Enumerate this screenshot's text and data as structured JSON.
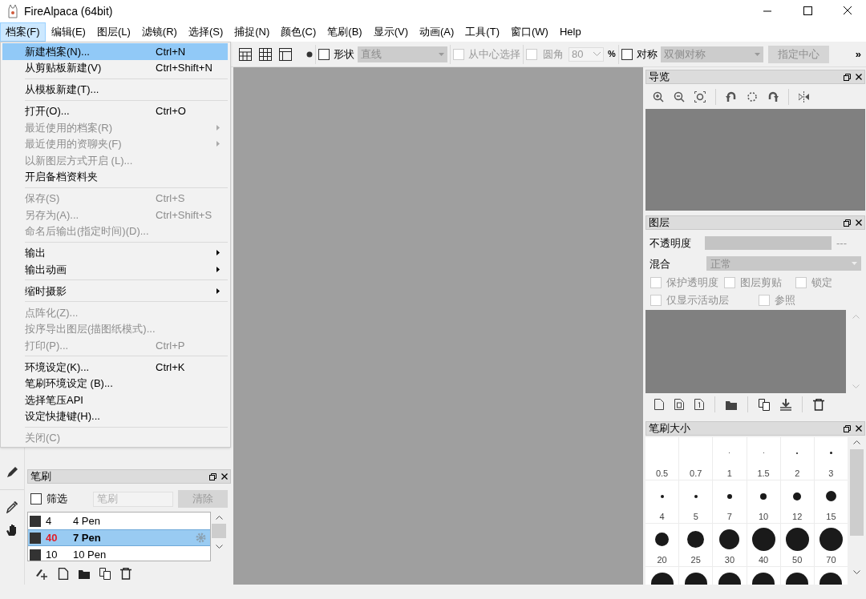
{
  "window": {
    "title": "FireAlpaca (64bit)"
  },
  "menu_bar": [
    {
      "label": "档案(F)",
      "selected": true
    },
    {
      "label": "编辑(E)",
      "selected": false
    },
    {
      "label": "图层(L)",
      "selected": false
    },
    {
      "label": "滤镜(R)",
      "selected": false
    },
    {
      "label": "选择(S)",
      "selected": false
    },
    {
      "label": "捕捉(N)",
      "selected": false
    },
    {
      "label": "颜色(C)",
      "selected": false
    },
    {
      "label": "笔刷(B)",
      "selected": false
    },
    {
      "label": "显示(V)",
      "selected": false
    },
    {
      "label": "动画(A)",
      "selected": false
    },
    {
      "label": "工具(T)",
      "selected": false
    },
    {
      "label": "窗口(W)",
      "selected": false
    },
    {
      "label": "Help",
      "selected": false
    }
  ],
  "toolbar": {
    "shape": {
      "label": "形状",
      "checked": false
    },
    "shape_type": {
      "value": "直线",
      "disabled": true
    },
    "from_center": {
      "label": "从中心选择",
      "checked": false,
      "disabled": true
    },
    "rounded": {
      "label": "圆角",
      "checked": false,
      "disabled": true
    },
    "corner": {
      "value": "80",
      "disabled": true
    },
    "percent": "%",
    "symmetry": {
      "label": "对称",
      "checked": false
    },
    "symmetry_type": {
      "value": "双侧对称",
      "disabled": true
    },
    "set_center": {
      "label": "指定中心",
      "disabled": true
    },
    "overflow": "»"
  },
  "file_menu": [
    {
      "kind": "item",
      "label": "新建档案(N)...",
      "shortcut": "Ctrl+N",
      "disabled": false,
      "submenu": false,
      "selected": true
    },
    {
      "kind": "item",
      "label": "从剪贴板新建(V)",
      "shortcut": "Ctrl+Shift+N",
      "disabled": false,
      "submenu": false,
      "selected": false
    },
    {
      "kind": "separator"
    },
    {
      "kind": "item",
      "label": "从模板新建(T)...",
      "disabled": false,
      "submenu": false,
      "selected": false
    },
    {
      "kind": "separator"
    },
    {
      "kind": "item",
      "label": "打开(O)...",
      "shortcut": "Ctrl+O",
      "disabled": false,
      "submenu": false,
      "selected": false
    },
    {
      "kind": "item",
      "label": "最近使用的档案(R)",
      "disabled": true,
      "submenu": true,
      "selected": false
    },
    {
      "kind": "item",
      "label": "最近使用的资聊夹(F)",
      "disabled": true,
      "submenu": true,
      "selected": false
    },
    {
      "kind": "item",
      "label": "以新图层方式开启 (L)...",
      "disabled": true,
      "submenu": false,
      "selected": false
    },
    {
      "kind": "item",
      "label": "开启备档资料夹",
      "disabled": false,
      "submenu": false,
      "selected": false
    },
    {
      "kind": "separator"
    },
    {
      "kind": "item",
      "label": "保存(S)",
      "shortcut": "Ctrl+S",
      "disabled": true,
      "submenu": false,
      "selected": false
    },
    {
      "kind": "item",
      "label": "另存为(A)...",
      "shortcut": "Ctrl+Shift+S",
      "disabled": true,
      "submenu": false,
      "selected": false
    },
    {
      "kind": "item",
      "label": "命名后输出(指定时间)(D)...",
      "disabled": true,
      "submenu": false,
      "selected": false
    },
    {
      "kind": "separator"
    },
    {
      "kind": "item",
      "label": "输出",
      "disabled": false,
      "submenu": true,
      "selected": false
    },
    {
      "kind": "item",
      "label": "输出动画",
      "disabled": false,
      "submenu": true,
      "selected": false
    },
    {
      "kind": "separator"
    },
    {
      "kind": "item",
      "label": "缩时摄影",
      "disabled": false,
      "submenu": true,
      "selected": false
    },
    {
      "kind": "separator"
    },
    {
      "kind": "item",
      "label": "点阵化(Z)...",
      "disabled": true,
      "submenu": false,
      "selected": false
    },
    {
      "kind": "item",
      "label": "按序导出图层(描图纸模式)...",
      "disabled": true,
      "submenu": false,
      "selected": false
    },
    {
      "kind": "item",
      "label": "打印(P)...",
      "shortcut": "Ctrl+P",
      "disabled": true,
      "submenu": false,
      "selected": false
    },
    {
      "kind": "separator"
    },
    {
      "kind": "item",
      "label": "环境设定(K)...",
      "shortcut": "Ctrl+K",
      "disabled": false,
      "submenu": false,
      "selected": false
    },
    {
      "kind": "item",
      "label": "笔刷环境设定 (B)...",
      "disabled": false,
      "submenu": false,
      "selected": false
    },
    {
      "kind": "item",
      "label": "选择笔压API",
      "disabled": false,
      "submenu": false,
      "selected": false
    },
    {
      "kind": "item",
      "label": "设定快捷键(H)...",
      "disabled": false,
      "submenu": false,
      "selected": false
    },
    {
      "kind": "separator"
    },
    {
      "kind": "item",
      "label": "关闭(C)",
      "disabled": true,
      "submenu": false,
      "selected": false
    }
  ],
  "brush_panel": {
    "title": "笔刷",
    "filter": {
      "label": "筛选",
      "checked": false
    },
    "search": {
      "placeholder": "笔刷"
    },
    "clear_button": {
      "label": "清除",
      "disabled": true
    },
    "brushes": [
      {
        "size": "4",
        "name": "4 Pen",
        "selected": false
      },
      {
        "size": "40",
        "name": "7 Pen",
        "selected": true
      },
      {
        "size": "10",
        "name": "10 Pen",
        "selected": false
      }
    ]
  },
  "navigator": {
    "title": "导览"
  },
  "layers": {
    "title": "图层",
    "opacity_label": "不透明度",
    "opacity_value": "---",
    "blend_label": "混合",
    "blend_value": "正常",
    "options": [
      {
        "label": "保护透明度",
        "checked": false,
        "disabled": true
      },
      {
        "label": "图层剪贴",
        "checked": false,
        "disabled": true
      },
      {
        "label": "锁定",
        "checked": false,
        "disabled": true
      },
      {
        "label": "仅显示活动层",
        "checked": false,
        "disabled": true
      },
      {
        "label": "参照",
        "checked": false,
        "disabled": true
      }
    ]
  },
  "brush_size": {
    "title": "笔刷大小",
    "sizes": [
      "0.5",
      "0.7",
      "1",
      "1.5",
      "2",
      "3",
      "4",
      "5",
      "7",
      "10",
      "12",
      "15",
      "20",
      "25",
      "30",
      "40",
      "50",
      "70"
    ]
  }
}
